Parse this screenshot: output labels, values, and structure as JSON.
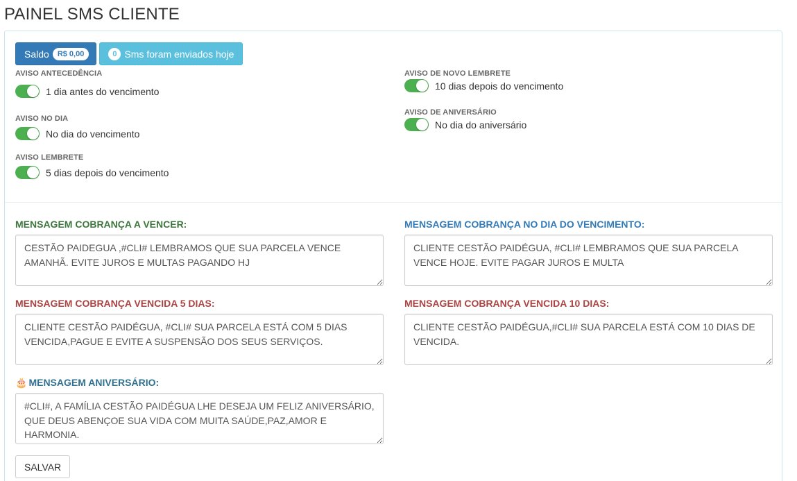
{
  "page": {
    "title": "PAINEL SMS CLIENTE"
  },
  "buttons": {
    "saldo_label": "Saldo",
    "saldo_value": "R$ 0,00",
    "sms_count": "0",
    "sms_label": "Sms foram enviados hoje",
    "save_label": "SALVAR"
  },
  "toggles": [
    {
      "label": "AVISO ANTECEDÊNCIA",
      "text": "1 dia antes do vencimento",
      "on": true
    },
    {
      "label": "AVISO NO DIA",
      "text": "No dia do vencimento",
      "on": true
    },
    {
      "label": "AVISO LEMBRETE",
      "text": "5 dias depois do vencimento",
      "on": true
    },
    {
      "label": "AVISO DE NOVO LEMBRETE",
      "text": "10 dias depois do vencimento",
      "on": true
    },
    {
      "label": "AVISO DE ANIVERSÁRIO",
      "text": "No dia do aniversário",
      "on": true
    }
  ],
  "messages": [
    {
      "label": "MENSAGEM COBRANÇA A VENCER:",
      "value": "CESTÃO PAIDEGUA ,#CLI# LEMBRAMOS QUE SUA PARCELA VENCE AMANHÃ. EVITE JUROS E MULTAS PAGANDO HJ"
    },
    {
      "label": "MENSAGEM COBRANÇA NO DIA DO VENCIMENTO:",
      "value": "CLIENTE CESTÃO PAIDÉGUA, #CLI# LEMBRAMOS QUE SUA PARCELA VENCE HOJE. EVITE PAGAR JUROS E MULTA"
    },
    {
      "label": "MENSAGEM COBRANÇA VENCIDA 5 DIAS:",
      "value": "CLIENTE CESTÃO PAIDÉGUA, #CLI# SUA PARCELA ESTÁ COM 5 DIAS VENCIDA,PAGUE E EVITE A SUSPENSÃO DOS SEUS SERVIÇOS."
    },
    {
      "label": "MENSAGEM COBRANÇA VENCIDA 10 DIAS:",
      "value": "CLIENTE CESTÃO PAIDÉGUA,#CLI# SUA PARCELA ESTÁ COM 10 DIAS DE VENCIDA."
    },
    {
      "label": "MENSAGEM ANIVERSÁRIO:",
      "value": "#CLI#, A FAMÍLIA CESTÃO PAIDÉGUA LHE DESEJA UM FELIZ ANIVERSÁRIO, QUE DEUS ABENÇOE SUA VIDA COM MUITA SAÚDE,PAZ,AMOR E HARMONIA."
    }
  ],
  "icons": {
    "birthday": "birthday-cake-icon"
  },
  "colors": {
    "primary": "#337ab7",
    "info": "#5bc0de",
    "toggle_on": "#4caf50",
    "label_green": "#3c763d",
    "label_blue": "#337ab7",
    "label_red": "#a94442",
    "label_teal": "#31708f"
  }
}
